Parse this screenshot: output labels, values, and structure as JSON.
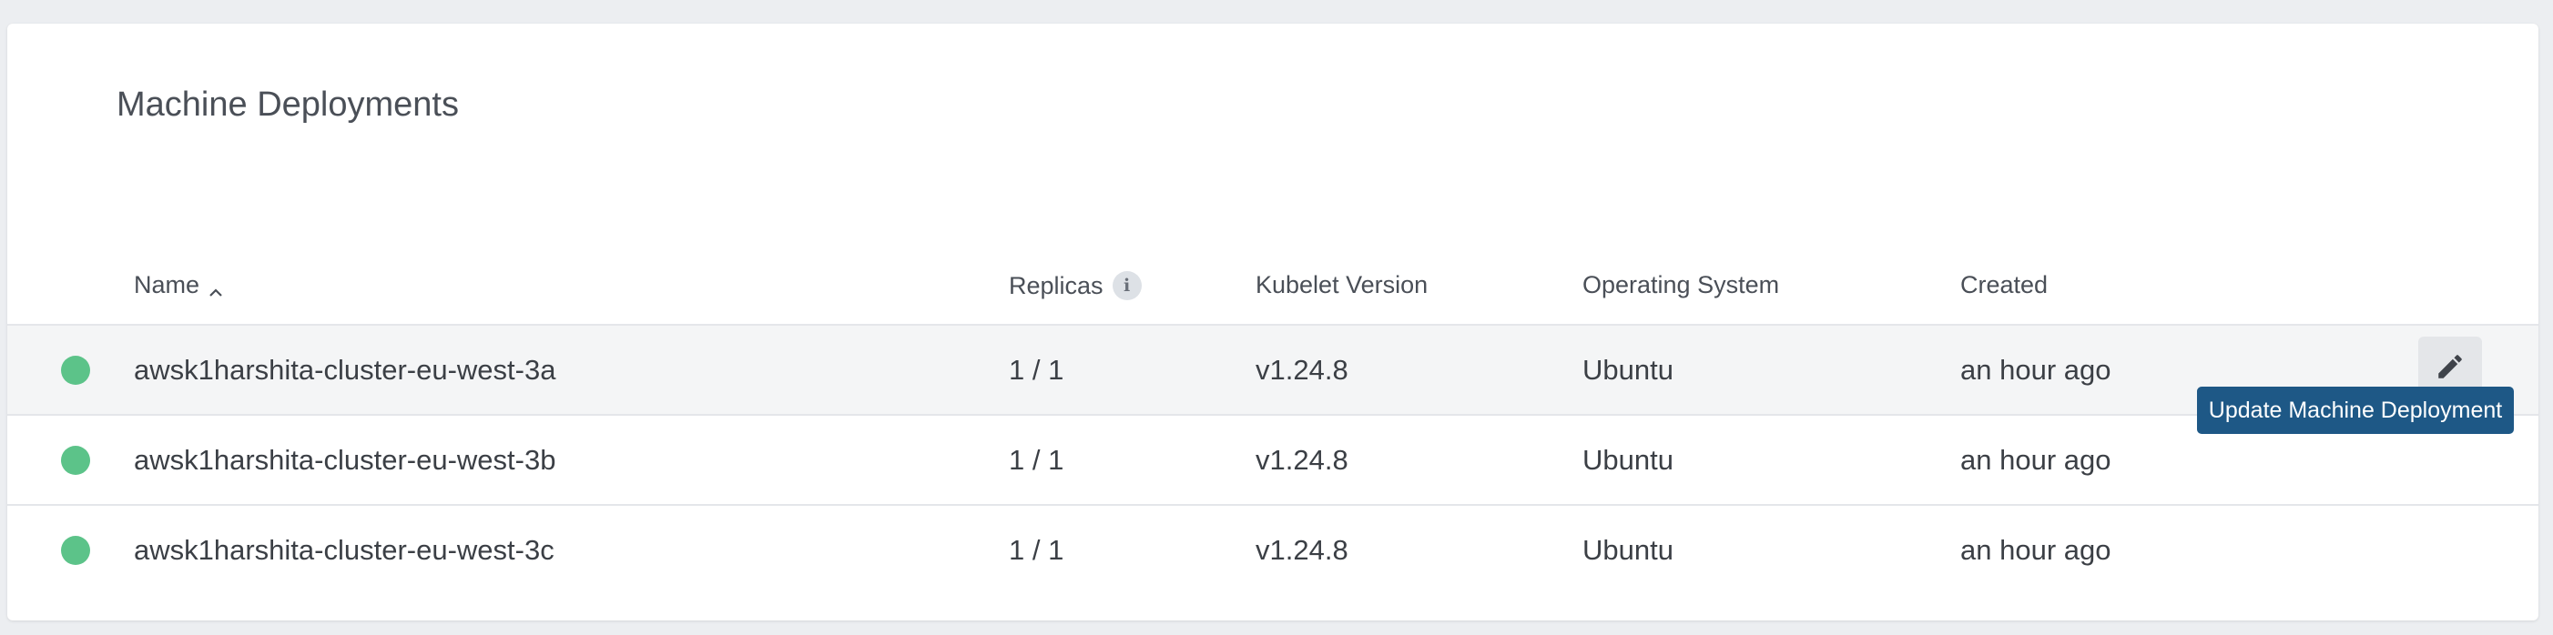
{
  "card": {
    "title": "Machine Deployments"
  },
  "table": {
    "columns": {
      "name": "Name",
      "replicas": "Replicas",
      "kubelet": "Kubelet Version",
      "os": "Operating System",
      "created": "Created"
    },
    "rows": [
      {
        "name": "awsk1harshita-cluster-eu-west-3a",
        "replicas": "1 / 1",
        "kubelet": "v1.24.8",
        "os": "Ubuntu",
        "created": "an hour ago"
      },
      {
        "name": "awsk1harshita-cluster-eu-west-3b",
        "replicas": "1 / 1",
        "kubelet": "v1.24.8",
        "os": "Ubuntu",
        "created": "an hour ago"
      },
      {
        "name": "awsk1harshita-cluster-eu-west-3c",
        "replicas": "1 / 1",
        "kubelet": "v1.24.8",
        "os": "Ubuntu",
        "created": "an hour ago"
      }
    ]
  },
  "icons": {
    "sort": "chevron-up-icon",
    "info": "info-icon",
    "edit": "pencil-icon",
    "status": "status-dot-icon"
  },
  "colors": {
    "status_ok": "#5cc389",
    "tooltip_bg": "#1e5886",
    "row_hover": "#f4f5f6"
  },
  "tooltip": {
    "text": "Update Machine Deployment"
  }
}
